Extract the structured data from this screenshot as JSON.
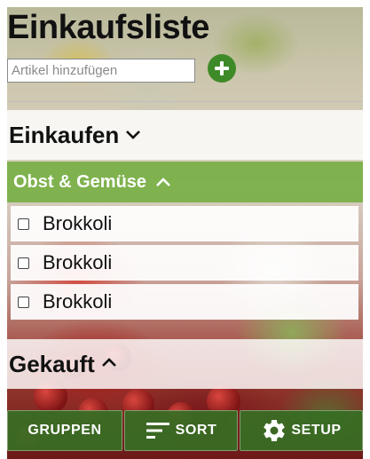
{
  "header": {
    "title": "Einkaufsliste",
    "add_placeholder": "Artikel hinzufügen"
  },
  "sections": {
    "shopping": {
      "label": "Einkaufen",
      "icon": "chevron-down-icon"
    },
    "purchased": {
      "label": "Gekauft",
      "icon": "chevron-up-icon"
    }
  },
  "group": {
    "label": "Obst & Gemüse",
    "icon": "chevron-up-icon",
    "color": "#78af46"
  },
  "items": [
    {
      "label": "Brokkoli",
      "checked": false
    },
    {
      "label": "Brokkoli",
      "checked": false
    },
    {
      "label": "Brokkoli",
      "checked": false
    }
  ],
  "toolbar": {
    "groups_label": "GRUPPEN",
    "sort_label": "SORT",
    "setup_label": "SETUP",
    "button_color": "#376e23"
  },
  "accent": "#3f8a28"
}
